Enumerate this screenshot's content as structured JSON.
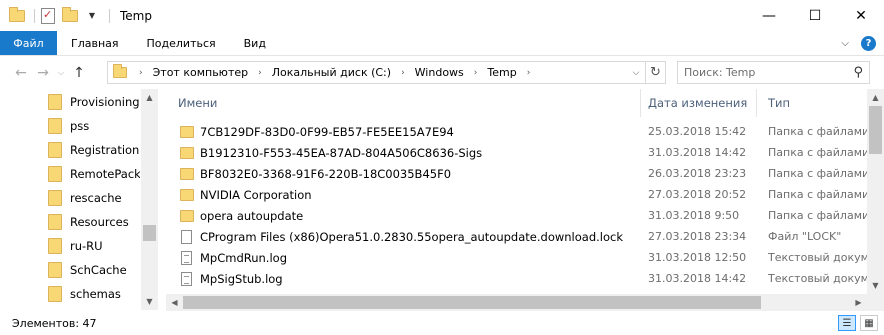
{
  "window": {
    "title": "Temp"
  },
  "window_controls": {
    "minimize": "—",
    "maximize": "☐",
    "close": "✕"
  },
  "ribbon": {
    "tabs": [
      "Файл",
      "Главная",
      "Поделиться",
      "Вид"
    ],
    "accent": "#1979ca",
    "help": "?"
  },
  "address": {
    "crumbs": [
      "Этот компьютер",
      "Локальный диск (C:)",
      "Windows",
      "Temp"
    ]
  },
  "search": {
    "placeholder": "Поиск: Temp"
  },
  "nav": {
    "items": [
      "Provisioning",
      "pss",
      "Registration",
      "RemotePackages",
      "rescache",
      "Resources",
      "ru-RU",
      "SchCache",
      "schemas"
    ]
  },
  "columns": {
    "name": "Имени",
    "date": "Дата изменения",
    "type": "Тип"
  },
  "files": [
    {
      "name": "7CB129DF-83D0-0F99-EB57-FE5EE15A7E94",
      "date": "25.03.2018 15:42",
      "type": "Папка с файлами",
      "kind": "folder"
    },
    {
      "name": "B1912310-F553-45EA-87AD-804A506C8636-Sigs",
      "date": "31.03.2018 14:42",
      "type": "Папка с файлами",
      "kind": "folder"
    },
    {
      "name": "BF8032E0-3368-91F6-220B-18C0035B45F0",
      "date": "26.03.2018 23:23",
      "type": "Папка с файлами",
      "kind": "folder"
    },
    {
      "name": "NVIDIA Corporation",
      "date": "27.03.2018 20:52",
      "type": "Папка с файлами",
      "kind": "folder"
    },
    {
      "name": "opera autoupdate",
      "date": "31.03.2018 9:50",
      "type": "Папка с файлами",
      "kind": "folder"
    },
    {
      "name": "CProgram Files (x86)Opera51.0.2830.55opera_autoupdate.download.lock",
      "date": "27.03.2018 23:34",
      "type": "Файл \"LOCK\"",
      "kind": "file"
    },
    {
      "name": "MpCmdRun.log",
      "date": "31.03.2018 12:50",
      "type": "Текстовый докум...",
      "kind": "log"
    },
    {
      "name": "MpSigStub.log",
      "date": "31.03.2018 14:42",
      "type": "Текстовый докум...",
      "kind": "log"
    }
  ],
  "status": {
    "count": "Элементов: 47"
  }
}
